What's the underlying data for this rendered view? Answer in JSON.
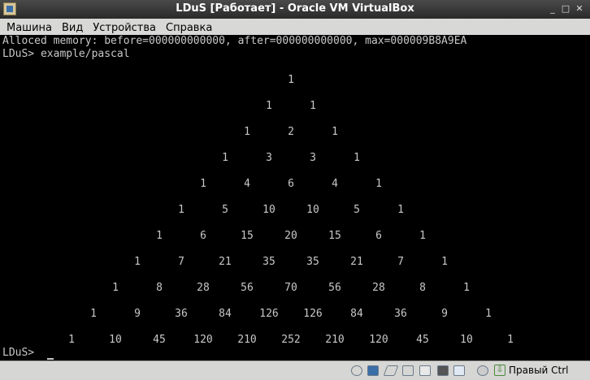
{
  "window": {
    "title": "LDuS [Работает] - Oracle VM VirtualBox",
    "minimize": "_",
    "maximize": "□",
    "close": "✕"
  },
  "menu": [
    {
      "label": "Машина"
    },
    {
      "label": "Вид"
    },
    {
      "label": "Устройства"
    },
    {
      "label": "Справка"
    }
  ],
  "console": {
    "lines": [
      "Alloced memory: before=000000000000, after=000000000000, max=000009B8A9EA",
      "LDuS> example/pascal"
    ],
    "prompt": "LDuS>",
    "pascal": [
      [
        1
      ],
      [
        1,
        1
      ],
      [
        1,
        2,
        1
      ],
      [
        1,
        3,
        3,
        1
      ],
      [
        1,
        4,
        6,
        4,
        1
      ],
      [
        1,
        5,
        10,
        10,
        5,
        1
      ],
      [
        1,
        6,
        15,
        20,
        15,
        6,
        1
      ],
      [
        1,
        7,
        21,
        35,
        35,
        21,
        7,
        1
      ],
      [
        1,
        8,
        28,
        56,
        70,
        56,
        28,
        8,
        1
      ],
      [
        1,
        9,
        36,
        84,
        126,
        126,
        84,
        36,
        9,
        1
      ],
      [
        1,
        10,
        45,
        120,
        210,
        252,
        210,
        120,
        45,
        10,
        1
      ]
    ]
  },
  "statusbar": {
    "icons": [
      "optical-drive-icon",
      "floppy-icon",
      "usb-icon",
      "network-icon",
      "shared-folder-icon",
      "display-icon",
      "video-capture-icon",
      "mouse-integration-icon"
    ],
    "host_key_label": "Правый Ctrl"
  }
}
